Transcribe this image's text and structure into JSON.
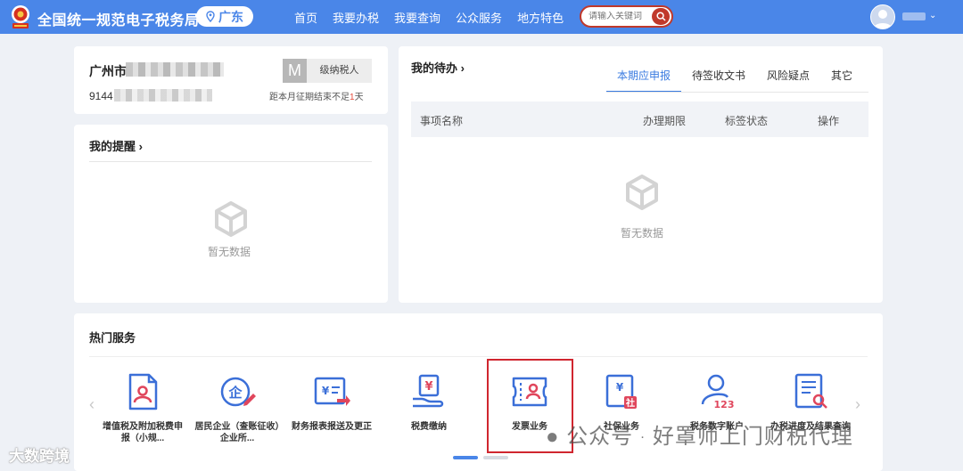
{
  "header": {
    "site_title": "全国统一规范电子税务局",
    "region": "广东",
    "nav": [
      "首页",
      "我要办税",
      "我要查询",
      "公众服务",
      "地方特色"
    ],
    "search_placeholder": "请输入关键词",
    "user_caret": "⌄"
  },
  "company": {
    "name_prefix": "广州市",
    "tax_id_prefix": "9144",
    "badge_letter": "M",
    "taxpayer_type": "级纳税人",
    "deadline_text": "距本月征期结束不足",
    "deadline_days": "1",
    "deadline_unit": "天"
  },
  "reminder": {
    "title": "我的提醒 ›",
    "empty_text": "暂无数据"
  },
  "todo": {
    "title": "我的待办 ›",
    "tabs": [
      "本期应申报",
      "待签收文书",
      "风险疑点",
      "其它"
    ],
    "active_tab": 0,
    "columns": [
      "事项名称",
      "办理期限",
      "标签状态",
      "操作"
    ],
    "empty_text": "暂无数据"
  },
  "hot_services": {
    "title": "热门服务",
    "prev_arrow": "‹",
    "next_arrow": "›",
    "items": [
      {
        "label": "增值税及附加税费申报（小规...",
        "icon": "vat-declaration-icon"
      },
      {
        "label": "居民企业（查账征收）企业所...",
        "icon": "enterprise-income-tax-icon"
      },
      {
        "label": "财务报表报送及更正",
        "icon": "financial-report-icon"
      },
      {
        "label": "税费缴纳",
        "icon": "tax-payment-icon"
      },
      {
        "label": "发票业务",
        "icon": "invoice-icon"
      },
      {
        "label": "社保业务",
        "icon": "social-security-icon"
      },
      {
        "label": "税务数字账户",
        "icon": "digital-account-icon"
      },
      {
        "label": "办税进度及结果查询",
        "icon": "progress-query-icon"
      }
    ],
    "selected_index": 4,
    "page_count": 2,
    "active_page": 0
  },
  "watermarks": {
    "left": "大数跨境",
    "right_account": "公众号",
    "right_name": "好罩师上门财税代理"
  },
  "colors": {
    "brand_blue": "#4a86e8",
    "highlight_red": "#d0262f",
    "active_tab": "#3a7be0",
    "icon_blue": "#3b6fd8",
    "icon_red": "#e0465c"
  }
}
